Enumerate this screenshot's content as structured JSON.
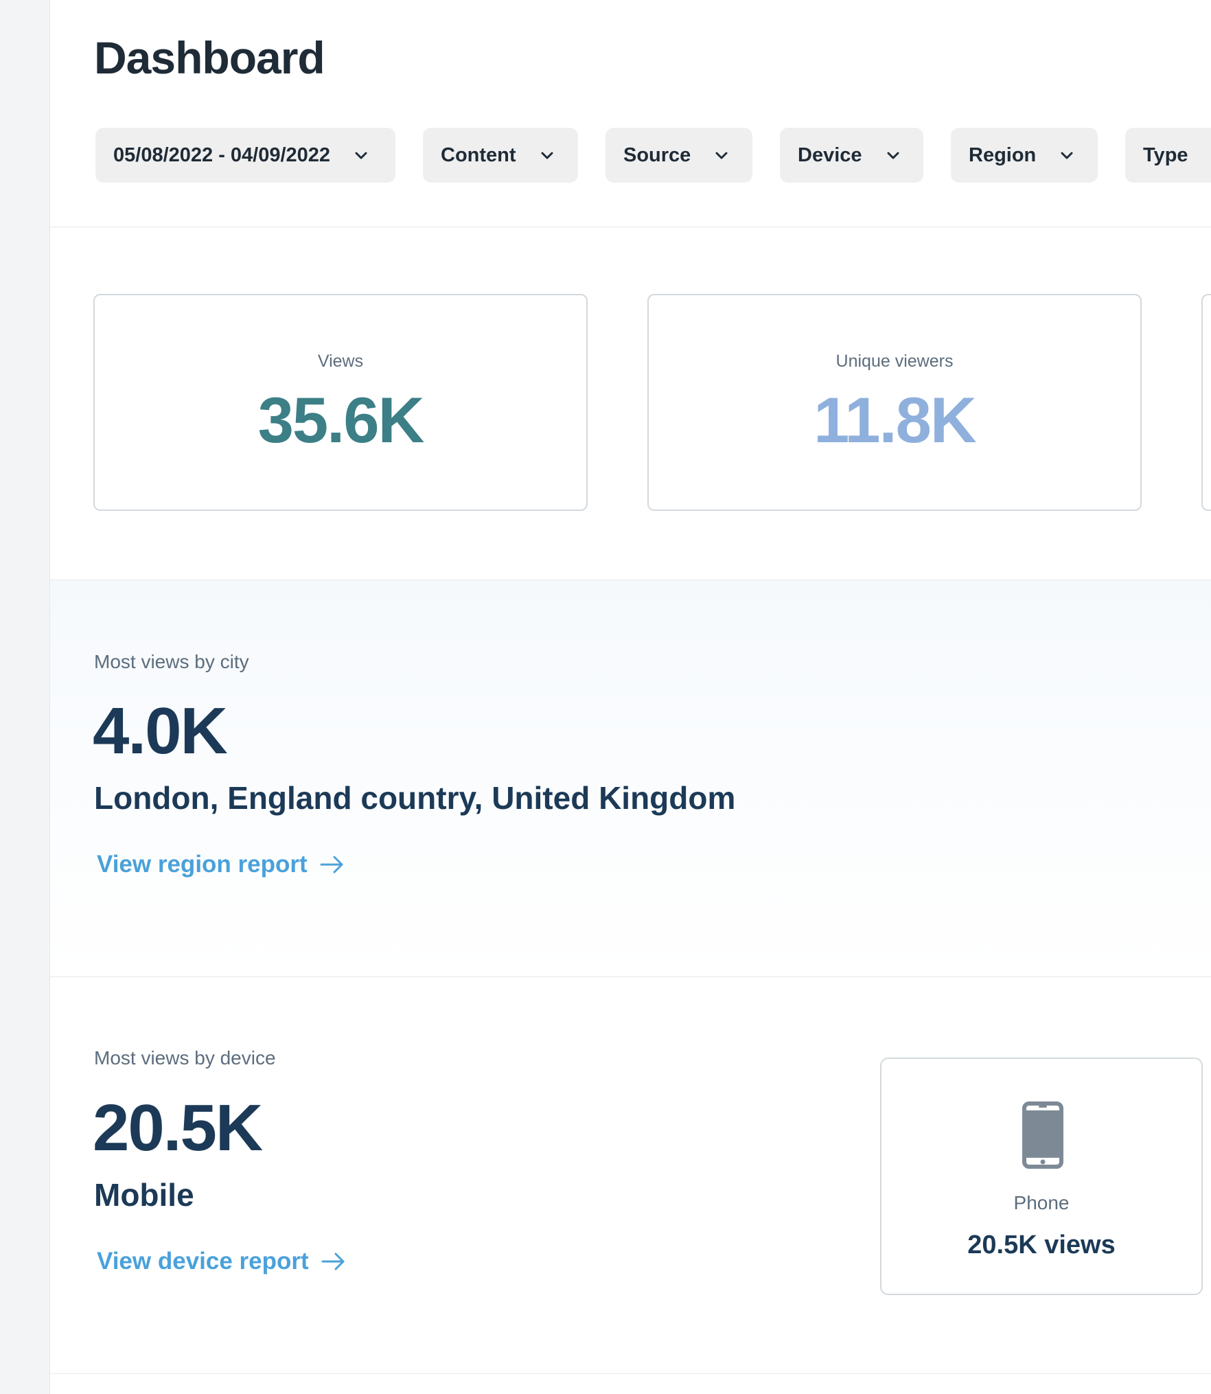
{
  "header": {
    "title": "Dashboard",
    "filters": [
      {
        "label": "05/08/2022 - 04/09/2022",
        "icon": "chevron-down-icon"
      },
      {
        "label": "Content",
        "icon": "chevron-down-icon"
      },
      {
        "label": "Source",
        "icon": "chevron-down-icon"
      },
      {
        "label": "Device",
        "icon": "chevron-down-icon"
      },
      {
        "label": "Region",
        "icon": "chevron-down-icon"
      },
      {
        "label": "Type",
        "icon": "chevron-down-icon"
      }
    ]
  },
  "stats": [
    {
      "label": "Views",
      "value": "35.6K",
      "color": "#3c7f86"
    },
    {
      "label": "Unique viewers",
      "value": "11.8K",
      "color": "#8fb0dc"
    }
  ],
  "city_section": {
    "label": "Most views by city",
    "value": "4.0K",
    "location": "London, England country, United Kingdom",
    "link": "View region report",
    "link_icon": "arrow-right-icon"
  },
  "device_section": {
    "label": "Most views by device",
    "value": "20.5K",
    "device": "Mobile",
    "link": "View device report",
    "link_icon": "arrow-right-icon",
    "card": {
      "icon": "phone-icon",
      "label": "Phone",
      "value": "20.5K views"
    }
  },
  "colors": {
    "link": "#4aa1da",
    "primary_text": "#1c3a57",
    "filter_bg": "#efefef"
  }
}
